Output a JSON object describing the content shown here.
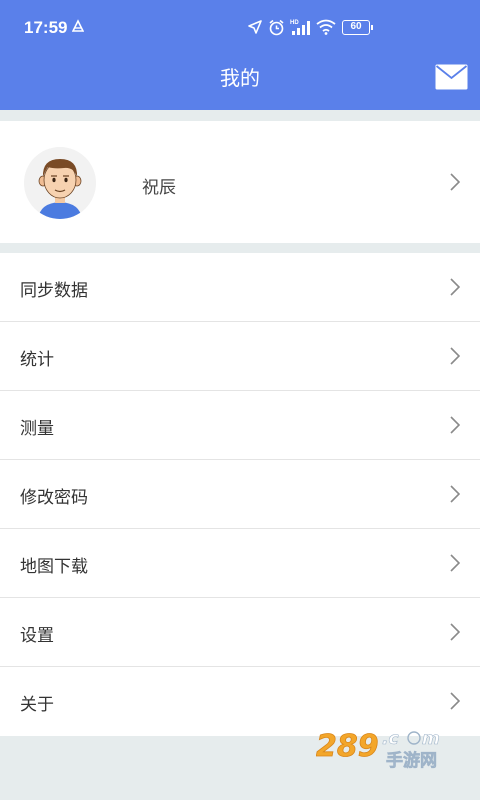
{
  "status_bar": {
    "time": "17:59",
    "battery": "60",
    "icons": [
      "location-icon",
      "alarm-icon",
      "hd-signal-icon",
      "wifi-icon",
      "battery-icon"
    ]
  },
  "header": {
    "title": "我的",
    "action_icon": "mail-icon"
  },
  "profile": {
    "name": "祝辰",
    "avatar_icon": "user-avatar"
  },
  "menu": {
    "items": [
      {
        "label": "同步数据"
      },
      {
        "label": "统计"
      },
      {
        "label": "测量"
      },
      {
        "label": "修改密码"
      },
      {
        "label": "地图下载"
      },
      {
        "label": "设置"
      },
      {
        "label": "关于"
      }
    ]
  },
  "watermark": {
    "logo_text": "289.com 手游网"
  },
  "colors": {
    "header_bg": "#5a80ea",
    "page_bg": "#e6eced"
  }
}
